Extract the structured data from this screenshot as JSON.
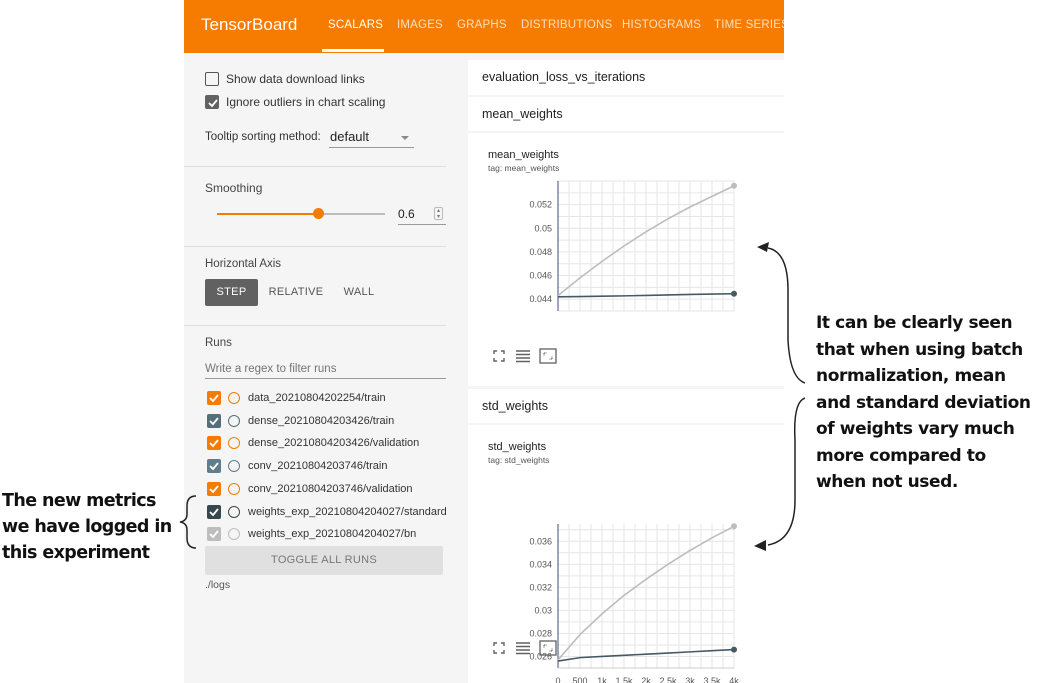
{
  "app": {
    "brand": "TensorBoard",
    "tabs": [
      "SCALARS",
      "IMAGES",
      "GRAPHS",
      "DISTRIBUTIONS",
      "HISTOGRAMS",
      "TIME SERIES"
    ],
    "active_tab": "SCALARS",
    "accent_color": "#f57c00"
  },
  "sidebar": {
    "show_download_links": {
      "label": "Show data download links",
      "checked": false
    },
    "ignore_outliers": {
      "label": "Ignore outliers in chart scaling",
      "checked": true
    },
    "tooltip_sorting": {
      "label": "Tooltip sorting method:",
      "value": "default"
    },
    "smoothing": {
      "title": "Smoothing",
      "value": "0.6",
      "fraction": 0.6
    },
    "horizontal_axis": {
      "title": "Horizontal Axis",
      "options": [
        "STEP",
        "RELATIVE",
        "WALL"
      ],
      "selected": "STEP"
    },
    "runs": {
      "title": "Runs",
      "filter_placeholder": "Write a regex to filter runs",
      "items": [
        {
          "label": "data_20210804202254/train",
          "checked": true,
          "color": "#f57c00",
          "circle_color": "#f57c00"
        },
        {
          "label": "dense_20210804203426/train",
          "checked": true,
          "color": "#546e7a",
          "circle_color": "#546e7a"
        },
        {
          "label": "dense_20210804203426/validation",
          "checked": true,
          "color": "#f57c00",
          "circle_color": "#f57c00"
        },
        {
          "label": "conv_20210804203746/train",
          "checked": true,
          "color": "#607d8b",
          "circle_color": "#607d8b"
        },
        {
          "label": "conv_20210804203746/validation",
          "checked": true,
          "color": "#f57c00",
          "circle_color": "#f57c00"
        },
        {
          "label": "weights_exp_20210804204027/standard",
          "checked": true,
          "color": "#37474f",
          "circle_color": "#37474f"
        },
        {
          "label": "weights_exp_20210804204027/bn",
          "checked": true,
          "color": "#bdbdbd",
          "circle_color": "#bdbdbd"
        }
      ],
      "toggle_all_label": "TOGGLE ALL RUNS",
      "logdir": "./logs"
    }
  },
  "main": {
    "groups": [
      "evaluation_loss_vs_iterations",
      "mean_weights",
      "std_weights"
    ],
    "icons": [
      "fullscreen-icon",
      "toggle-y-log-icon",
      "fit-domain-icon"
    ]
  },
  "chart_data": [
    {
      "type": "line",
      "title": "mean_weights",
      "subtitle": "tag: mean_weights",
      "x_range": [
        0,
        4000
      ],
      "y_ticks": [
        0.044,
        0.046,
        0.048,
        0.05,
        0.052
      ],
      "y_tick_labels": [
        "0.044",
        "0.046",
        "0.048",
        "0.05",
        "0.052"
      ],
      "ylim": [
        0.043,
        0.054
      ],
      "grid": true,
      "series": [
        {
          "name": "weights_exp_20210804204027/bn",
          "color": "#bdbdbd",
          "x": [
            0,
            500,
            1000,
            1500,
            2000,
            2500,
            3000,
            3500,
            4000
          ],
          "y": [
            0.0443,
            0.0458,
            0.0472,
            0.0485,
            0.0497,
            0.0508,
            0.0518,
            0.0527,
            0.0536
          ]
        },
        {
          "name": "weights_exp_20210804204027/standard",
          "color": "#455a64",
          "x": [
            0,
            500,
            1000,
            1500,
            2000,
            2500,
            3000,
            3500,
            4000
          ],
          "y": [
            0.0442,
            0.04422,
            0.04425,
            0.04428,
            0.04432,
            0.04436,
            0.0444,
            0.04443,
            0.04446
          ]
        }
      ]
    },
    {
      "type": "line",
      "title": "std_weights",
      "subtitle": "tag: std_weights",
      "x_ticks": [
        0,
        500,
        1000,
        1500,
        2000,
        2500,
        3000,
        3500,
        4000
      ],
      "x_tick_labels": [
        "0",
        "500",
        "1k",
        "1.5k",
        "2k",
        "2.5k",
        "3k",
        "3.5k",
        "4k"
      ],
      "x_range": [
        0,
        4000
      ],
      "y_ticks": [
        0.026,
        0.028,
        0.03,
        0.032,
        0.034,
        0.036
      ],
      "y_tick_labels": [
        "0.026",
        "0.028",
        "0.03",
        "0.032",
        "0.034",
        "0.036"
      ],
      "ylim": [
        0.025,
        0.0375
      ],
      "grid": true,
      "series": [
        {
          "name": "weights_exp_20210804204027/bn",
          "color": "#bdbdbd",
          "x": [
            0,
            500,
            1000,
            1500,
            2000,
            2500,
            3000,
            3500,
            4000
          ],
          "y": [
            0.0257,
            0.0279,
            0.0297,
            0.0313,
            0.0327,
            0.034,
            0.0352,
            0.0363,
            0.0373
          ]
        },
        {
          "name": "weights_exp_20210804204027/standard",
          "color": "#455a64",
          "x": [
            0,
            500,
            1000,
            1500,
            2000,
            2500,
            3000,
            3500,
            4000
          ],
          "y": [
            0.0256,
            0.0259,
            0.026,
            0.0261,
            0.0262,
            0.0263,
            0.0264,
            0.0265,
            0.0266
          ]
        }
      ]
    }
  ],
  "annotations": {
    "left": [
      "The new metrics",
      "we have logged in",
      "this experiment"
    ],
    "right": [
      "It can be clearly seen",
      "that when using batch",
      "normalization, mean",
      "and standard deviation",
      "of weights vary much",
      "more compared to",
      "when not used."
    ]
  }
}
